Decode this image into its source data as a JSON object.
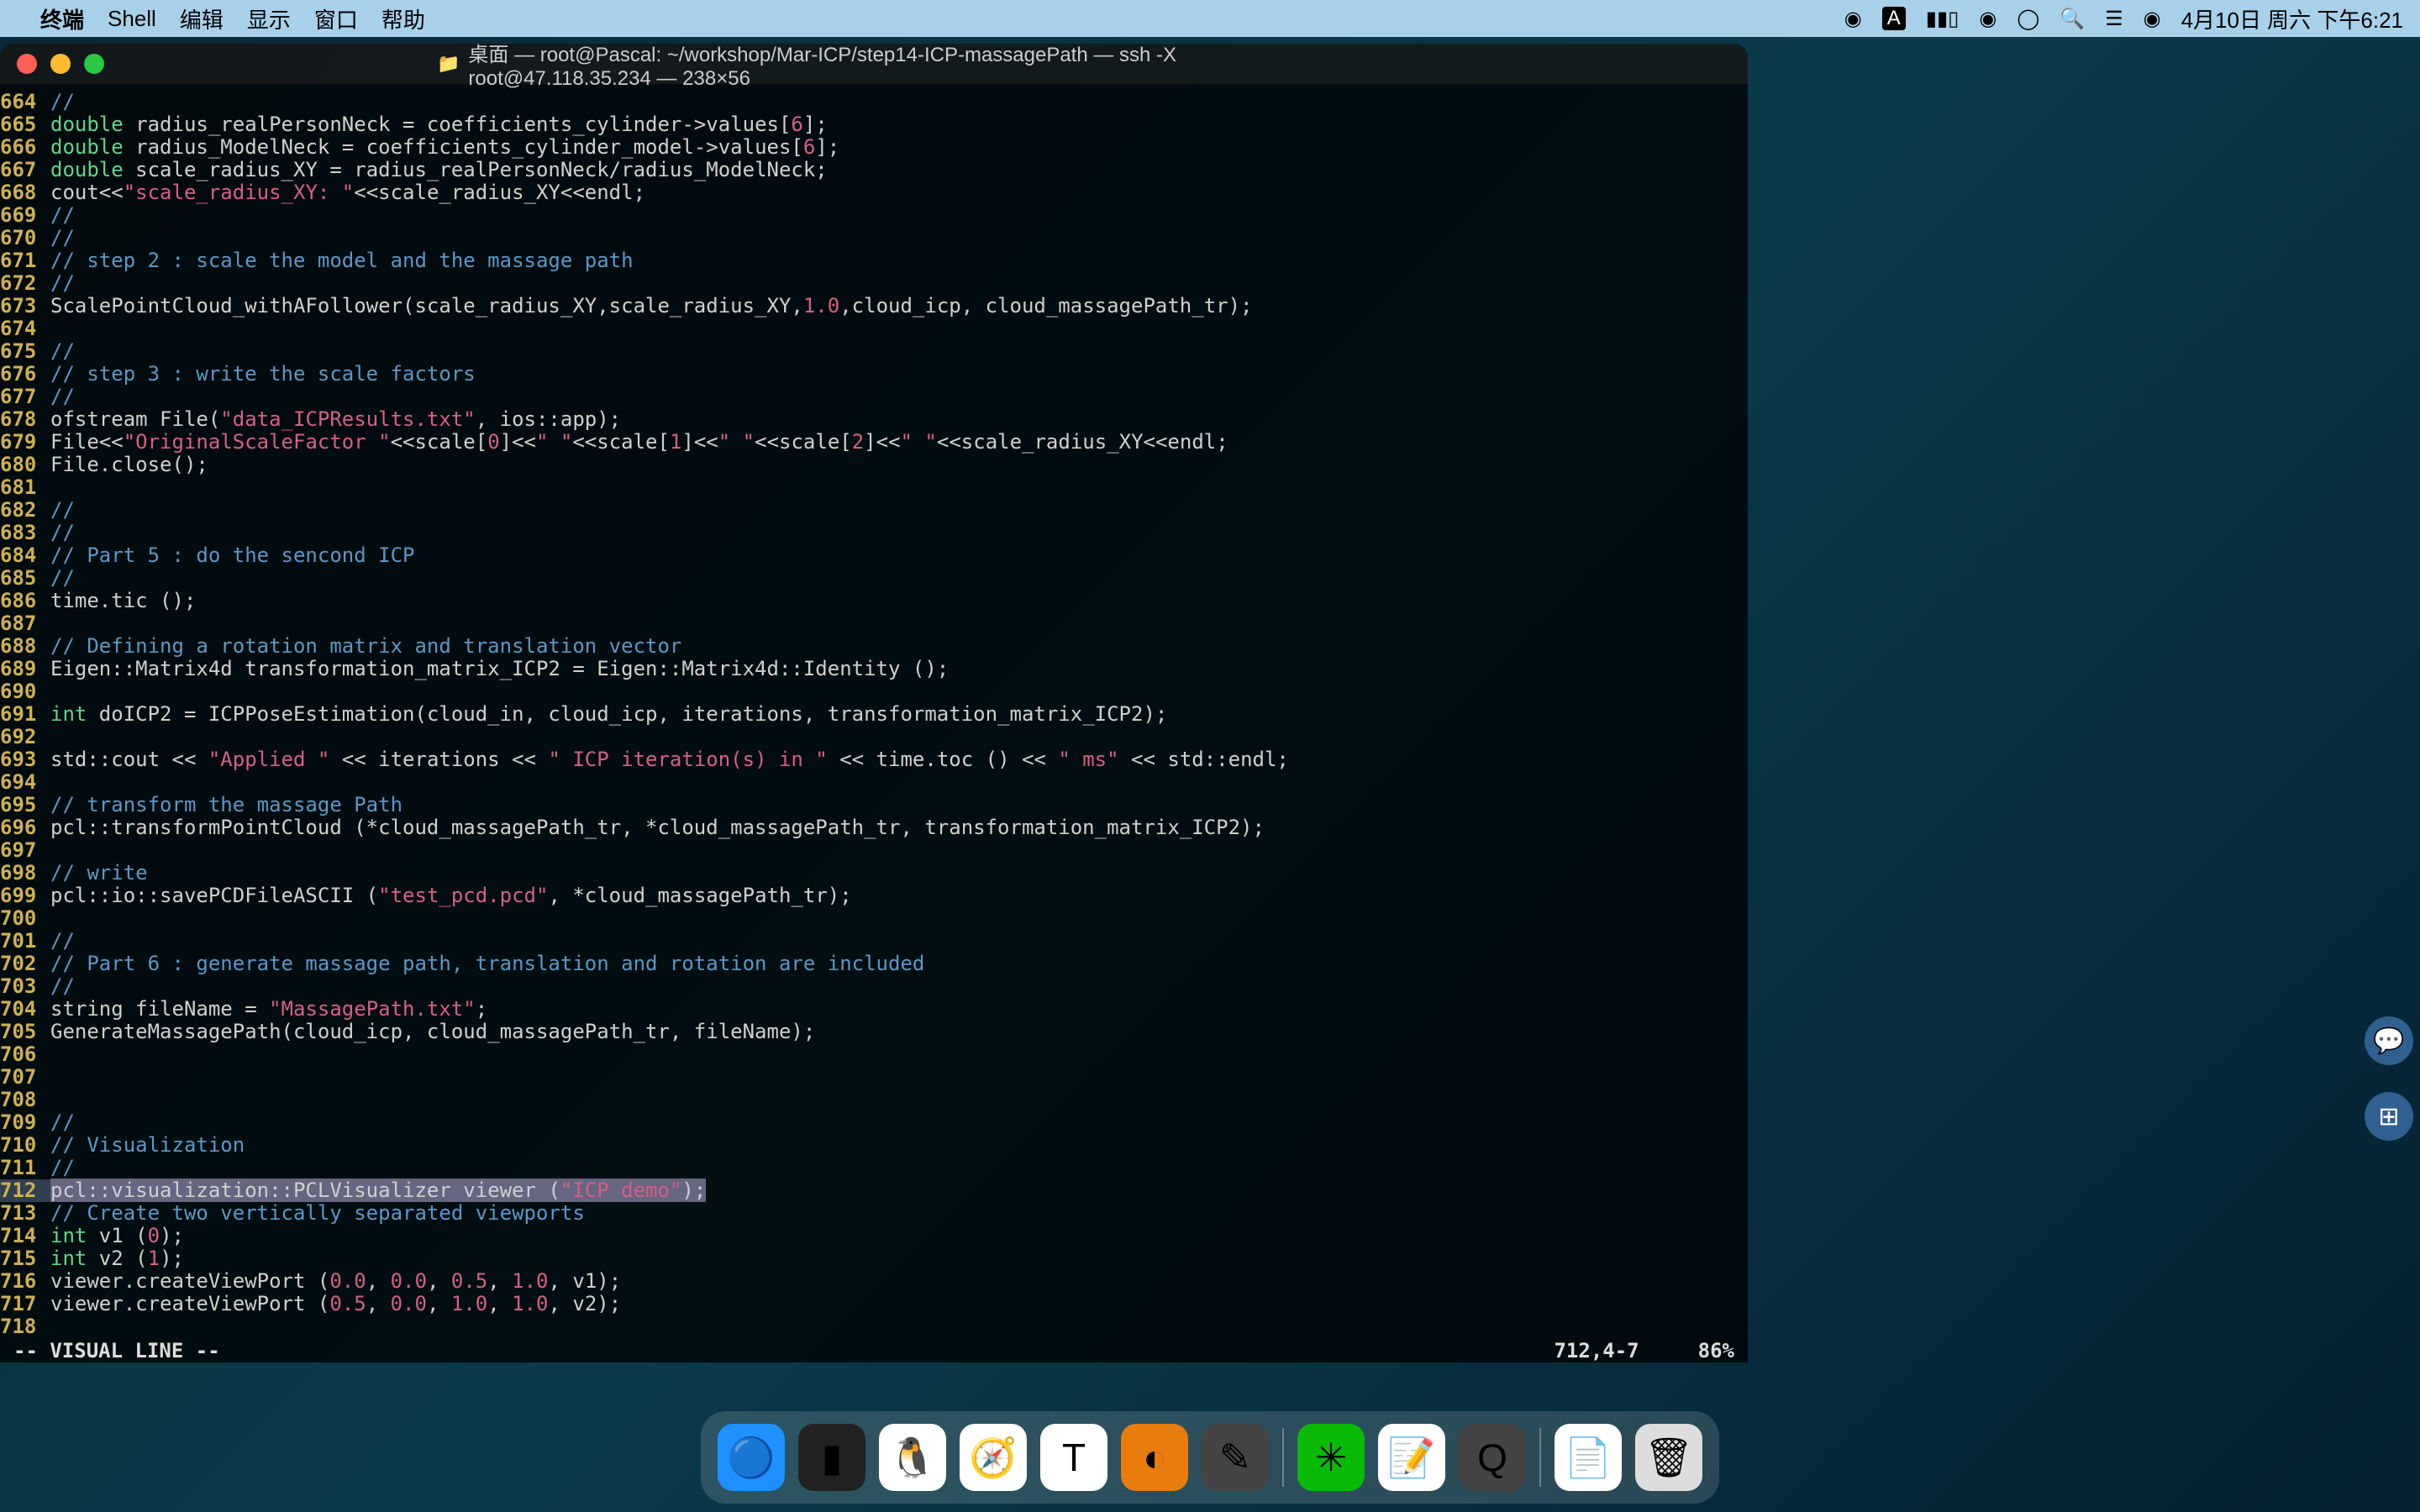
{
  "menubar": {
    "app": "终端",
    "items": [
      "Shell",
      "编辑",
      "显示",
      "窗口",
      "帮助"
    ],
    "clock": "4月10日 周六 下午6:21"
  },
  "window": {
    "title": "桌面 — root@Pascal: ~/workshop/Mar-ICP/step14-ICP-massagePath — ssh -X root@47.118.35.234 — 238×56"
  },
  "status": {
    "mode": "-- VISUAL LINE --",
    "position": "712,4-7",
    "percent": "86%"
  },
  "code": [
    {
      "n": "664",
      "seg": [
        {
          "c": "c-comment",
          "t": "//"
        }
      ]
    },
    {
      "n": "665",
      "seg": [
        {
          "c": "c-type",
          "t": "double"
        },
        {
          "t": " radius_realPersonNeck = coefficients_cylinder->values["
        },
        {
          "c": "c-number",
          "t": "6"
        },
        {
          "t": "];"
        }
      ]
    },
    {
      "n": "666",
      "seg": [
        {
          "c": "c-type",
          "t": "double"
        },
        {
          "t": " radius_ModelNeck = coefficients_cylinder_model->values["
        },
        {
          "c": "c-number",
          "t": "6"
        },
        {
          "t": "];"
        }
      ]
    },
    {
      "n": "667",
      "seg": [
        {
          "c": "c-type",
          "t": "double"
        },
        {
          "t": " scale_radius_XY = radius_realPersonNeck/radius_ModelNeck;"
        }
      ]
    },
    {
      "n": "668",
      "seg": [
        {
          "t": "cout<<"
        },
        {
          "c": "c-string",
          "t": "\"scale_radius_XY: \""
        },
        {
          "t": "<<scale_radius_XY<<endl;"
        }
      ]
    },
    {
      "n": "669",
      "seg": [
        {
          "c": "c-comment",
          "t": "//"
        }
      ]
    },
    {
      "n": "670",
      "seg": [
        {
          "c": "c-comment",
          "t": "//"
        }
      ]
    },
    {
      "n": "671",
      "seg": [
        {
          "c": "c-comment",
          "t": "// step 2 : scale the model and the massage path"
        }
      ]
    },
    {
      "n": "672",
      "seg": [
        {
          "c": "c-comment",
          "t": "//"
        }
      ]
    },
    {
      "n": "673",
      "seg": [
        {
          "t": "ScalePointCloud_withAFollower(scale_radius_XY,scale_radius_XY,"
        },
        {
          "c": "c-number",
          "t": "1.0"
        },
        {
          "t": ",cloud_icp, cloud_massagePath_tr);"
        }
      ]
    },
    {
      "n": "674",
      "seg": []
    },
    {
      "n": "675",
      "seg": [
        {
          "c": "c-comment",
          "t": "//"
        }
      ]
    },
    {
      "n": "676",
      "seg": [
        {
          "c": "c-comment",
          "t": "// step 3 : write the scale factors"
        }
      ]
    },
    {
      "n": "677",
      "seg": [
        {
          "c": "c-comment",
          "t": "//"
        }
      ]
    },
    {
      "n": "678",
      "seg": [
        {
          "t": "ofstream File("
        },
        {
          "c": "c-string",
          "t": "\"data_ICPResults.txt\""
        },
        {
          "t": ", ios::app);"
        }
      ]
    },
    {
      "n": "679",
      "seg": [
        {
          "t": "File<<"
        },
        {
          "c": "c-string",
          "t": "\"OriginalScaleFactor \""
        },
        {
          "t": "<<scale["
        },
        {
          "c": "c-number",
          "t": "0"
        },
        {
          "t": "]<<"
        },
        {
          "c": "c-string",
          "t": "\" \""
        },
        {
          "t": "<<scale["
        },
        {
          "c": "c-number",
          "t": "1"
        },
        {
          "t": "]<<"
        },
        {
          "c": "c-string",
          "t": "\" \""
        },
        {
          "t": "<<scale["
        },
        {
          "c": "c-number",
          "t": "2"
        },
        {
          "t": "]<<"
        },
        {
          "c": "c-string",
          "t": "\" \""
        },
        {
          "t": "<<scale_radius_XY<<endl;"
        }
      ]
    },
    {
      "n": "680",
      "seg": [
        {
          "t": "File.close();"
        }
      ]
    },
    {
      "n": "681",
      "seg": []
    },
    {
      "n": "682",
      "seg": [
        {
          "c": "c-comment",
          "t": "//"
        }
      ]
    },
    {
      "n": "683",
      "seg": [
        {
          "c": "c-comment",
          "t": "//"
        }
      ]
    },
    {
      "n": "684",
      "seg": [
        {
          "c": "c-comment",
          "t": "// Part 5 : do the sencond ICP"
        }
      ]
    },
    {
      "n": "685",
      "seg": [
        {
          "c": "c-comment",
          "t": "//"
        }
      ]
    },
    {
      "n": "686",
      "seg": [
        {
          "t": "time.tic ();"
        }
      ]
    },
    {
      "n": "687",
      "seg": []
    },
    {
      "n": "688",
      "seg": [
        {
          "c": "c-comment",
          "t": "// Defining a rotation matrix and translation vector"
        }
      ]
    },
    {
      "n": "689",
      "seg": [
        {
          "t": "Eigen::Matrix4d transformation_matrix_ICP2 = Eigen::Matrix4d::Identity ();"
        }
      ]
    },
    {
      "n": "690",
      "seg": []
    },
    {
      "n": "691",
      "seg": [
        {
          "c": "c-type",
          "t": "int"
        },
        {
          "t": " doICP2 = ICPPoseEstimation(cloud_in, cloud_icp, iterations, transformation_matrix_ICP2);"
        }
      ]
    },
    {
      "n": "692",
      "seg": []
    },
    {
      "n": "693",
      "seg": [
        {
          "t": "std::cout << "
        },
        {
          "c": "c-string",
          "t": "\"Applied \""
        },
        {
          "t": " << iterations << "
        },
        {
          "c": "c-string",
          "t": "\" ICP iteration(s) in \""
        },
        {
          "t": " << time.toc () << "
        },
        {
          "c": "c-string",
          "t": "\" ms\""
        },
        {
          "t": " << std::endl;"
        }
      ]
    },
    {
      "n": "694",
      "seg": []
    },
    {
      "n": "695",
      "seg": [
        {
          "c": "c-comment",
          "t": "// transform the massage Path"
        }
      ]
    },
    {
      "n": "696",
      "seg": [
        {
          "t": "pcl::transformPointCloud (*cloud_massagePath_tr, *cloud_massagePath_tr, transformation_matrix_ICP2);"
        }
      ]
    },
    {
      "n": "697",
      "seg": []
    },
    {
      "n": "698",
      "seg": [
        {
          "c": "c-comment",
          "t": "// write"
        }
      ]
    },
    {
      "n": "699",
      "seg": [
        {
          "t": "pcl::io::savePCDFileASCII ("
        },
        {
          "c": "c-string",
          "t": "\"test_pcd.pcd\""
        },
        {
          "t": ", *cloud_massagePath_tr);"
        }
      ]
    },
    {
      "n": "700",
      "seg": []
    },
    {
      "n": "701",
      "seg": [
        {
          "c": "c-comment",
          "t": "//"
        }
      ]
    },
    {
      "n": "702",
      "seg": [
        {
          "c": "c-comment",
          "t": "// Part 6 : generate massage path, translation and rotation are included"
        }
      ]
    },
    {
      "n": "703",
      "seg": [
        {
          "c": "c-comment",
          "t": "//"
        }
      ]
    },
    {
      "n": "704",
      "seg": [
        {
          "t": "string fileName = "
        },
        {
          "c": "c-string",
          "t": "\"MassagePath.txt\""
        },
        {
          "t": ";"
        }
      ]
    },
    {
      "n": "705",
      "seg": [
        {
          "t": "GenerateMassagePath(cloud_icp, cloud_massagePath_tr, fileName);"
        }
      ]
    },
    {
      "n": "706",
      "seg": []
    },
    {
      "n": "707",
      "seg": []
    },
    {
      "n": "708",
      "seg": []
    },
    {
      "n": "709",
      "seg": [
        {
          "c": "c-comment",
          "t": "//"
        }
      ]
    },
    {
      "n": "710",
      "seg": [
        {
          "c": "c-comment",
          "t": "// Visualization"
        }
      ]
    },
    {
      "n": "711",
      "seg": [
        {
          "c": "c-comment",
          "t": "//"
        }
      ]
    },
    {
      "n": "712",
      "cur": true,
      "sel": true,
      "seg": [
        {
          "t": "pcl::visualization::PCLVisualizer viewer ("
        },
        {
          "c": "c-string",
          "t": "\"ICP demo\""
        },
        {
          "t": ");"
        }
      ]
    },
    {
      "n": "713",
      "seg": [
        {
          "c": "c-comment",
          "t": "// Create two vertically separated viewports"
        }
      ]
    },
    {
      "n": "714",
      "seg": [
        {
          "c": "c-type",
          "t": "int"
        },
        {
          "t": " v1 ("
        },
        {
          "c": "c-number",
          "t": "0"
        },
        {
          "t": ");"
        }
      ]
    },
    {
      "n": "715",
      "seg": [
        {
          "c": "c-type",
          "t": "int"
        },
        {
          "t": " v2 ("
        },
        {
          "c": "c-number",
          "t": "1"
        },
        {
          "t": ");"
        }
      ]
    },
    {
      "n": "716",
      "seg": [
        {
          "t": "viewer.createViewPort ("
        },
        {
          "c": "c-number",
          "t": "0.0"
        },
        {
          "t": ", "
        },
        {
          "c": "c-number",
          "t": "0.0"
        },
        {
          "t": ", "
        },
        {
          "c": "c-number",
          "t": "0.5"
        },
        {
          "t": ", "
        },
        {
          "c": "c-number",
          "t": "1.0"
        },
        {
          "t": ", v1);"
        }
      ]
    },
    {
      "n": "717",
      "seg": [
        {
          "t": "viewer.createViewPort ("
        },
        {
          "c": "c-number",
          "t": "0.5"
        },
        {
          "t": ", "
        },
        {
          "c": "c-number",
          "t": "0.0"
        },
        {
          "t": ", "
        },
        {
          "c": "c-number",
          "t": "1.0"
        },
        {
          "t": ", "
        },
        {
          "c": "c-number",
          "t": "1.0"
        },
        {
          "t": ", v2);"
        }
      ]
    },
    {
      "n": "718",
      "seg": []
    }
  ],
  "dock": {
    "items": [
      {
        "name": "finder",
        "glyph": "🔵",
        "bg": "#1e90ff"
      },
      {
        "name": "terminal",
        "glyph": "▮",
        "bg": "#222"
      },
      {
        "name": "qq",
        "glyph": "🐧",
        "bg": "#fff"
      },
      {
        "name": "safari",
        "glyph": "🧭",
        "bg": "#fff"
      },
      {
        "name": "textedit",
        "glyph": "T",
        "bg": "#fff"
      },
      {
        "name": "blender",
        "glyph": "◐",
        "bg": "#e87d0d"
      },
      {
        "name": "markdown",
        "glyph": "✎",
        "bg": "#444"
      }
    ],
    "items2": [
      {
        "name": "wechat",
        "glyph": "✳",
        "bg": "#09bb07"
      },
      {
        "name": "notes",
        "glyph": "📝",
        "bg": "#fff"
      },
      {
        "name": "quicktime",
        "glyph": "Q",
        "bg": "#444"
      }
    ],
    "items3": [
      {
        "name": "file",
        "glyph": "📄",
        "bg": "#fff"
      },
      {
        "name": "trash",
        "glyph": "🗑",
        "bg": "#ddd"
      }
    ]
  }
}
